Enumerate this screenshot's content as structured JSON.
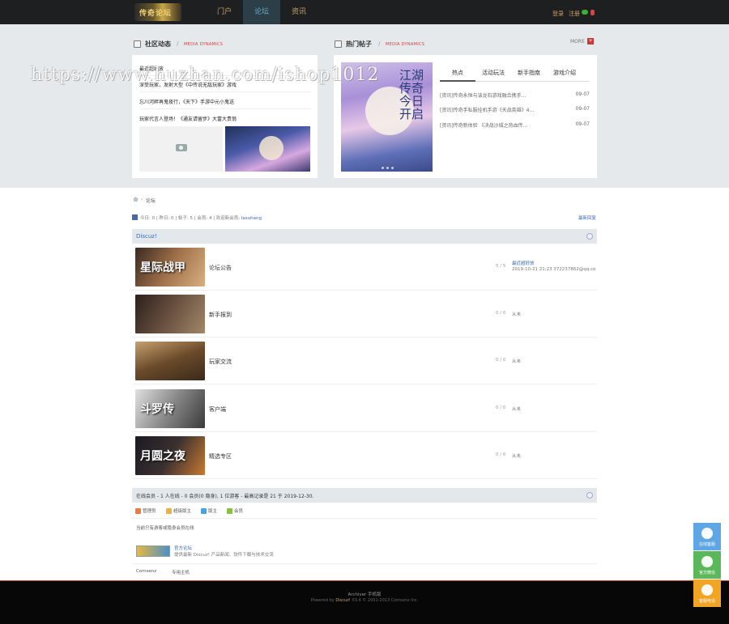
{
  "header": {
    "logo_text": "传奇论坛",
    "nav": [
      {
        "label": "门户",
        "active": false
      },
      {
        "label": "论坛",
        "active": true
      },
      {
        "label": "资讯",
        "active": false
      }
    ],
    "login": "登录",
    "register": "注册"
  },
  "community": {
    "title": "社区动态",
    "sub": "MEDIA DYNAMICS",
    "items": [
      "最近超好放",
      "深受玩家，发射大型《中传说无敌玩家》游戏",
      "忘川河畔再鬼夜行，《天下》手游中元小鬼送",
      "玩家代言人登场！《通友请留步》大富大贵翁"
    ]
  },
  "hot": {
    "title": "热门帖子",
    "sub": "MEDIA DYNAMICS",
    "more": "MORE",
    "cover_text": "江湖 传奇 今日开启",
    "tabs": [
      "热点",
      "活动玩法",
      "新手指南",
      "游戏介绍"
    ],
    "rows": [
      {
        "title": "[资讯]传奇永恒与该龙石游戏融合携手…",
        "date": "09-07"
      },
      {
        "title": "[资讯]传奇手私服挂机手游《天战英雄》4…",
        "date": "09-07"
      },
      {
        "title": "[资讯]传奇新体验 《决战沙城之热血传…",
        "date": "09-07"
      }
    ]
  },
  "watermark": "https://www.huzhan.com/ishop1012",
  "breadcrumb": {
    "sep": "›",
    "current": "论坛"
  },
  "stats": {
    "text": "今日: 0 | 昨日: 0 | 帖子: 5 | 会员: 4 | 欢迎新会员:",
    "new_member": "lasuhang",
    "latest_reply": "最新回复"
  },
  "group": {
    "name": "Discuz!"
  },
  "forums": [
    {
      "name": "论坛公告",
      "thumb_text": "星际战甲",
      "count": "5 / 5",
      "last_title": "最近超好放",
      "last_meta": "2019-10-21 21:23 372237862@qq.co",
      "color": "#6a4a3a"
    },
    {
      "name": "新手报到",
      "thumb_text": "",
      "count": "0 / 0",
      "last": "从未",
      "color": "#5a4a44"
    },
    {
      "name": "玩家交流",
      "thumb_text": "",
      "count": "0 / 0",
      "last": "从未",
      "color": "#7a5a3a"
    },
    {
      "name": "客户端",
      "thumb_text": "斗罗传",
      "count": "0 / 0",
      "last": "从未",
      "color": "#6a6a6a"
    },
    {
      "name": "精选专区",
      "thumb_text": "月圆之夜",
      "count": "0 / 0",
      "last": "从未",
      "color": "#3a3a40"
    }
  ],
  "online": {
    "text": "在线会员 - 1 人在线 - 0 会员(0 隐身), 1 位游客 - 最高记录是 21 于 2019-12-30.",
    "legend": [
      {
        "label": "管理员",
        "color": "#f07a3a"
      },
      {
        "label": "超级版主",
        "color": "#f0b040"
      },
      {
        "label": "版主",
        "color": "#4aa0e0"
      },
      {
        "label": "会员",
        "color": "#8ac040"
      }
    ],
    "note": "当前只有游客或隐身会员在线"
  },
  "friend_link": {
    "title": "官方论坛",
    "desc": "提供最新 Discuz! 产品新闻、软件下载与技术交流",
    "links": [
      "Comsenz",
      "专用主机"
    ]
  },
  "footer": {
    "links": "Archiver   手机版",
    "power_prefix": "Powered by",
    "power_brand": "Discuz!",
    "power_suffix": "X3.4  © 2001-2013 Comsenz Inc."
  },
  "float_buttons": [
    {
      "label": "在线客服",
      "icon": "qq-icon",
      "color": "#5fa7e4"
    },
    {
      "label": "官方微信",
      "icon": "wechat-icon",
      "color": "#5bb85a"
    },
    {
      "label": "客服电话",
      "icon": "phone-icon",
      "color": "#f2a424"
    }
  ]
}
